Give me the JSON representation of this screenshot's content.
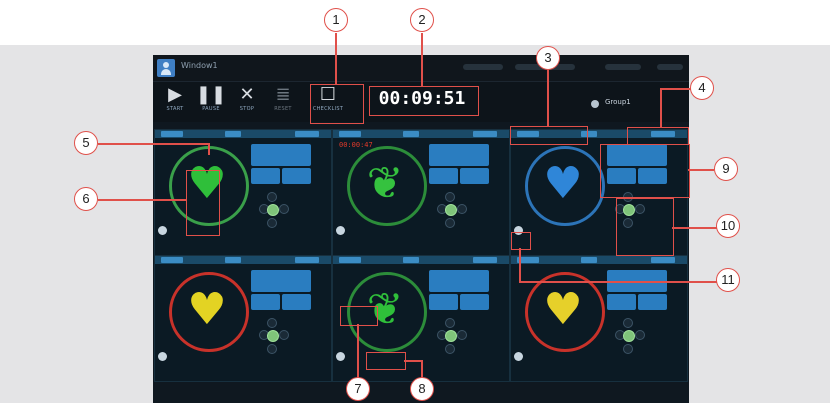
{
  "app": {
    "title": "Window1",
    "group_label": "Group1"
  },
  "toolbar": {
    "start_label": "START",
    "pause_label": "PAUSE",
    "stop_label": "STOP",
    "reset_label": "RESET",
    "checklist_label": "CHECKLIST",
    "timer": "00:09:51"
  },
  "icons": {
    "start": "play-icon",
    "pause": "pause-icon",
    "stop": "stop-x-icon",
    "reset": "reset-icon",
    "checklist": "checklist-icon"
  },
  "callouts": [
    "1",
    "2",
    "3",
    "4",
    "5",
    "6",
    "7",
    "8",
    "9",
    "10",
    "11"
  ],
  "panels": [
    {
      "organ": "heart",
      "organ_color": "#2fbf3a",
      "ring_color": "#3aa04a"
    },
    {
      "organ": "lungs",
      "organ_color": "#35c23f",
      "ring_color": "#2c8d3a",
      "time": "00:00:47"
    },
    {
      "organ": "heart",
      "organ_color": "#2f86d8",
      "ring_color": "#2c74b8"
    },
    {
      "organ": "heart",
      "organ_color": "#e3d323",
      "ring_color": "#c8322a"
    },
    {
      "organ": "lungs",
      "organ_color": "#2fbf3a",
      "ring_color": "#2c8d3a"
    },
    {
      "organ": "heart",
      "organ_color": "#e6d02a",
      "ring_color": "#c8322a"
    }
  ],
  "colors": {
    "accent": "#2a7dc0",
    "callout": "#e0504a",
    "screen_bg": "#0f1820"
  }
}
